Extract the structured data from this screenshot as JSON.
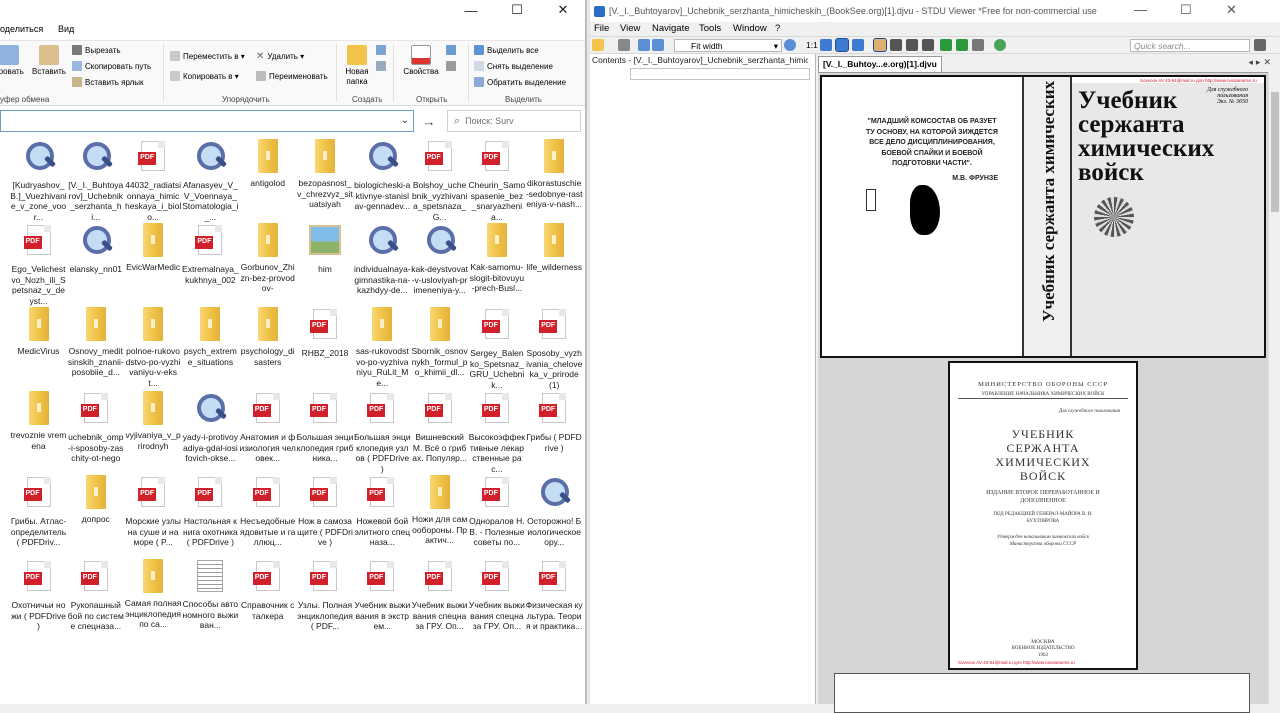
{
  "explorer": {
    "menu": [
      "оделиться",
      "Вид"
    ],
    "window_buttons": [
      "—",
      "☐",
      "✕"
    ],
    "ribbon": {
      "clipboard": {
        "big": [
          "ировать",
          "Вставить"
        ],
        "small": [
          "Вырезать",
          "Скопировать путь",
          "Вставить ярлык"
        ],
        "group": "уфер обмена"
      },
      "organize": {
        "small": [
          "Переместить в ▾",
          "Копировать в ▾",
          "Удалить ▾",
          "Переименовать"
        ],
        "group": "Упорядочить"
      },
      "create": {
        "big": [
          "Новая папка"
        ],
        "group": "Создать"
      },
      "open": {
        "big": [
          "Свойства"
        ],
        "group": "Открыть"
      },
      "select": {
        "small": [
          "Выделить все",
          "Снять выделение",
          "Обратить выделение"
        ],
        "group": "Выделить"
      }
    },
    "search_placeholder": "Поиск: Surv",
    "files": [
      {
        "name": "[Kudryashov_B.]_Vuezhivanie_v_zone_voor...",
        "type": "djvu"
      },
      {
        "name": "[V._I._Buhtoyarov]_Uchebnik_serzhanta_hi...",
        "type": "djvu"
      },
      {
        "name": "44032_radiatsionnaya_himicheskaya_i_biolo...",
        "type": "pdf"
      },
      {
        "name": "Afanasyev_V_V_Voennaya_Stomatologia_i_...",
        "type": "djvu"
      },
      {
        "name": "antigolod",
        "type": "folder"
      },
      {
        "name": "bezopasnost_v_chrezvyz_situatsiyah",
        "type": "folder"
      },
      {
        "name": "biologicheski-aktivnye-stanislav-gennadev...",
        "type": "djvu"
      },
      {
        "name": "Bolshoy_uchebnik_vyzhivania_spetsnaza_G...",
        "type": "pdf"
      },
      {
        "name": "Cheurin_Samospasenie_bez_snaryazhenia...",
        "type": "pdf"
      },
      {
        "name": "dikorastuschie-sedobnye-rasteniya-v-nash...",
        "type": "folder"
      },
      {
        "name": "Ego_Velichestvo_Nozh_ili_Spetsnaz_v_deyst...",
        "type": "pdf"
      },
      {
        "name": "elansky_nn01",
        "type": "djvu"
      },
      {
        "name": "EvicWarMedic",
        "type": "folder"
      },
      {
        "name": "Extremalnaya_kukhnya_002",
        "type": "pdf"
      },
      {
        "name": "Gorbunov_Zhizn-bez-provodov-",
        "type": "folder"
      },
      {
        "name": "him",
        "type": "image"
      },
      {
        "name": "individualnaya-gimnastika-na-kazhdyy-de...",
        "type": "djvu"
      },
      {
        "name": "kak-deystvovat-v-usloviyah-primeneniya-y...",
        "type": "djvu"
      },
      {
        "name": "Kak-samomu-slogit-bitovuyu-prech-Busl...",
        "type": "folder"
      },
      {
        "name": "life_wilderness",
        "type": "folder"
      },
      {
        "name": "MedicVirus",
        "type": "folder"
      },
      {
        "name": "Osnovy_meditsinskih_znanii-posobiie_d...",
        "type": "folder"
      },
      {
        "name": "polnoe-rukovodstvo-po-vyzhivaniyu-v-ekst...",
        "type": "folder"
      },
      {
        "name": "psych_extreme_situations",
        "type": "folder"
      },
      {
        "name": "psychology_disasters",
        "type": "folder"
      },
      {
        "name": "RHBZ_2018",
        "type": "pdf"
      },
      {
        "name": "sas-rukovodstvo-po-vyzhivaniyu_RuLit_Me...",
        "type": "folder"
      },
      {
        "name": "Sbornik_osnovnykh_formul_po_khimii_dl...",
        "type": "folder"
      },
      {
        "name": "Sergey_Balenko_Spetsnaz_GRU_Uchebnik...",
        "type": "pdf"
      },
      {
        "name": "Sposoby_vyzhivania_cheloveka_v_prirode(1)",
        "type": "pdf"
      },
      {
        "name": "trevoznie vremena",
        "type": "folder"
      },
      {
        "name": "uchebnik_omp-i-sposoby-zaschity-ot-nego",
        "type": "pdf"
      },
      {
        "name": "vyjivaniya_v_prirodnyh",
        "type": "folder"
      },
      {
        "name": "yady-i-protivoyadiya-gdal-iosifovich-okse...",
        "type": "djvu"
      },
      {
        "name": "Анатомия и физиология человек...",
        "type": "pdf"
      },
      {
        "name": "Большая энциклопедия грибника...",
        "type": "pdf"
      },
      {
        "name": "Большая энциклопедия узлов ( PDFDrive )",
        "type": "pdf"
      },
      {
        "name": "Вишневский М. Всё о грибах. Популяр...",
        "type": "pdf"
      },
      {
        "name": "Высокоэффективные лекарственные рас...",
        "type": "pdf"
      },
      {
        "name": "Грибы ( PDFDrive )",
        "type": "pdf"
      },
      {
        "name": "Грибы. Атлас-определитель ( PDFDriv...",
        "type": "pdf"
      },
      {
        "name": "допрос",
        "type": "folder"
      },
      {
        "name": "Морские узлы на суше и на море ( P...",
        "type": "pdf"
      },
      {
        "name": "Настольная книга охотника ( PDFDrive )",
        "type": "pdf"
      },
      {
        "name": "Несъедобные ядовитые и галлюц...",
        "type": "pdf"
      },
      {
        "name": "Нож в самозащите ( PDFDrive )",
        "type": "pdf"
      },
      {
        "name": "Ножевой бой элитного спецназа...",
        "type": "pdf"
      },
      {
        "name": "Ножи для самообороны. Практич...",
        "type": "folder"
      },
      {
        "name": "Одноралов Н.В. - Полезные советы по...",
        "type": "pdf"
      },
      {
        "name": "Осторожно! Биологическое ору...",
        "type": "djvu"
      },
      {
        "name": "Охотничьи ножи ( PDFDrive )",
        "type": "pdf"
      },
      {
        "name": "Рукопашный бой по системе спецназа...",
        "type": "pdf"
      },
      {
        "name": "Самая полная энциклопедия по са...",
        "type": "folder"
      },
      {
        "name": "Способы автономного выживан...",
        "type": "doc"
      },
      {
        "name": "Справочник сталкера",
        "type": "pdf"
      },
      {
        "name": "Узлы. Полная энциклопедия ( PDF...",
        "type": "pdf"
      },
      {
        "name": "Учебник выживания в экстрем...",
        "type": "pdf"
      },
      {
        "name": "Учебник выживания спецназа ГРУ. Оп...",
        "type": "pdf"
      },
      {
        "name": "Учебник выживания спецназа ГРУ. Оп...",
        "type": "pdf"
      },
      {
        "name": "Физическая культура. Теория и практика...",
        "type": "pdf"
      }
    ]
  },
  "viewer": {
    "title": "[V._I._Buhtoyarov]_Uchebnik_serzhanta_himicheskih_(BookSee.org)[1].djvu - STDU Viewer *Free for non-commercial use",
    "menu": [
      "File",
      "View",
      "Navigate",
      "Tools",
      "Window",
      "?"
    ],
    "window_buttons": [
      "—",
      "☐",
      "✕"
    ],
    "fit_mode": "Fit width",
    "page_indicator": "1:1",
    "quick_search_placeholder": "Quick search...",
    "contents_tab": "Contents - [V._I._Buhtoyarov]_Uchebnik_serzhanta_himic",
    "doc_tab": "[V._I._Buhtoy...e.org)[1].djvu",
    "page1": {
      "quote": "\"МЛАДШИЙ КОМСОСТАВ ОБ РАЗУЕТ ТУ ОСНОВУ, НА КОТОРОЙ ЗИЖДЕТСЯ ВСЕ ДЕЛО ДИСЦИПЛИНИРОВАНИЯ, БОЕВОЙ СПАЙКИ И БОЕВОЙ ПОДГОТОВКИ ЧАСТИ\".",
      "quote_author": "М.В. ФРУНЗЕ",
      "spine": "Учебник сержанта химических войск",
      "cover_title": "Учебник сержанта химических войск",
      "red_note": "Sovvoov AV 43-64@mail.ru для http://www.russianarms.ru",
      "stamp": "Для служебного пользования",
      "stamp_no": "Экз. № 3650"
    },
    "page2": {
      "ministry": "МИНИСТЕРСТВО ОБОРОНЫ СССР",
      "department": "УПРАВЛЕНИЕ НАЧАЛЬНИКА ХИМИЧЕСКИХ ВОЙСК",
      "classification": "Для служебного пользования",
      "title": "УЧЕБНИК СЕРЖАНТА ХИМИЧЕСКИХ ВОЙСК",
      "edition": "ИЗДАНИЕ ВТОРОЕ ПЕРЕРАБОТАННОЕ И ДОПОЛНЕННОЕ",
      "editor": "ПОД РЕДАКЦИЕЙ ГЕНЕРАЛ-МАЙОРА В. И. БУХТОЯРОВА",
      "approved": "Утвержден начальником химических войск Министерства обороны СССР",
      "city": "МОСКВА",
      "publisher": "ВОЕННОЕ ИЗДАТЕЛЬСТВО",
      "year": "1963",
      "red_note": "Sovvoov AV 43-64@mail.ru для http://www.russianarms.ru"
    }
  }
}
